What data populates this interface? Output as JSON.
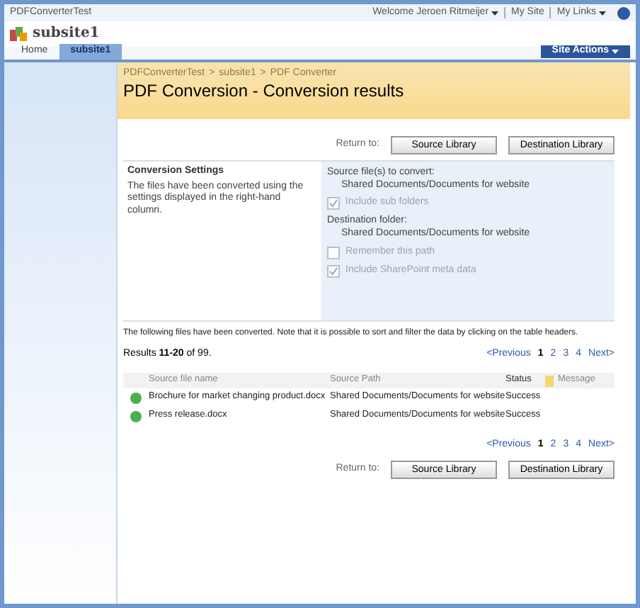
{
  "top_bar": {
    "site": "PDFConverterTest",
    "welcome": "Welcome Jeroen Ritmeijer",
    "links": [
      "My Site",
      "My Links"
    ]
  },
  "site_title": "subsite1",
  "tabs": [
    {
      "label": "Home",
      "selected": false
    },
    {
      "label": "subsite1",
      "selected": true
    }
  ],
  "site_actions": "Site Actions",
  "breadcrumb": [
    "PDFConverterTest",
    "subsite1",
    "PDF Converter"
  ],
  "breadcrumb_separator": ">",
  "page_title": "PDF Conversion - Conversion results",
  "return_bars": [
    {
      "label": "Return to:",
      "buttons": [
        "Source Library",
        "Destination Library"
      ]
    },
    {
      "label": "Return to:",
      "buttons": [
        "Source Library",
        "Destination Library"
      ]
    }
  ],
  "settings": {
    "title": "Conversion Settings",
    "description": "The files have been converted using the settings displayed in the right-hand column.",
    "source_label": "Source file(s) to convert:",
    "source_value": "Shared Documents/Documents for website",
    "include_sub_folders": {
      "label": "Include sub folders",
      "checked": true
    },
    "destination_label": "Destination folder:",
    "destination_value": "Shared Documents/Documents for website",
    "remember_path": {
      "label": "Remember this path",
      "checked": false
    },
    "include_meta": {
      "label": "Include SharePoint meta data",
      "checked": true
    }
  },
  "note": "The following files have been converted. Note that it is possible to sort and filter the data by clicking on the table headers.",
  "results": "Results **11-20** of 99.",
  "pagers": [
    {
      "previous": "<Previous",
      "pages": [
        {
          "label": "1",
          "selected": true
        },
        {
          "label": "2",
          "selected": false
        },
        {
          "label": "3",
          "selected": false
        },
        {
          "label": "4",
          "selected": false
        }
      ],
      "next": "Next>"
    },
    {
      "previous": "<Previous",
      "pages": [
        {
          "label": "1",
          "selected": true
        },
        {
          "label": "2",
          "selected": false
        },
        {
          "label": "3",
          "selected": false
        },
        {
          "label": "4",
          "selected": false
        }
      ],
      "next": "Next>"
    }
  ],
  "table": {
    "columns": [
      "Source file name",
      "Source Path",
      "Status",
      "Message"
    ],
    "rows": [
      {
        "file": "Brochure for market changing product.docx",
        "path": "Shared Documents/Documents for website",
        "status": "Success",
        "color": "#4caf50"
      },
      {
        "file": "Press release.docx",
        "path": "Shared Documents/Documents for website",
        "status": "Success",
        "color": "#4caf50"
      }
    ]
  }
}
